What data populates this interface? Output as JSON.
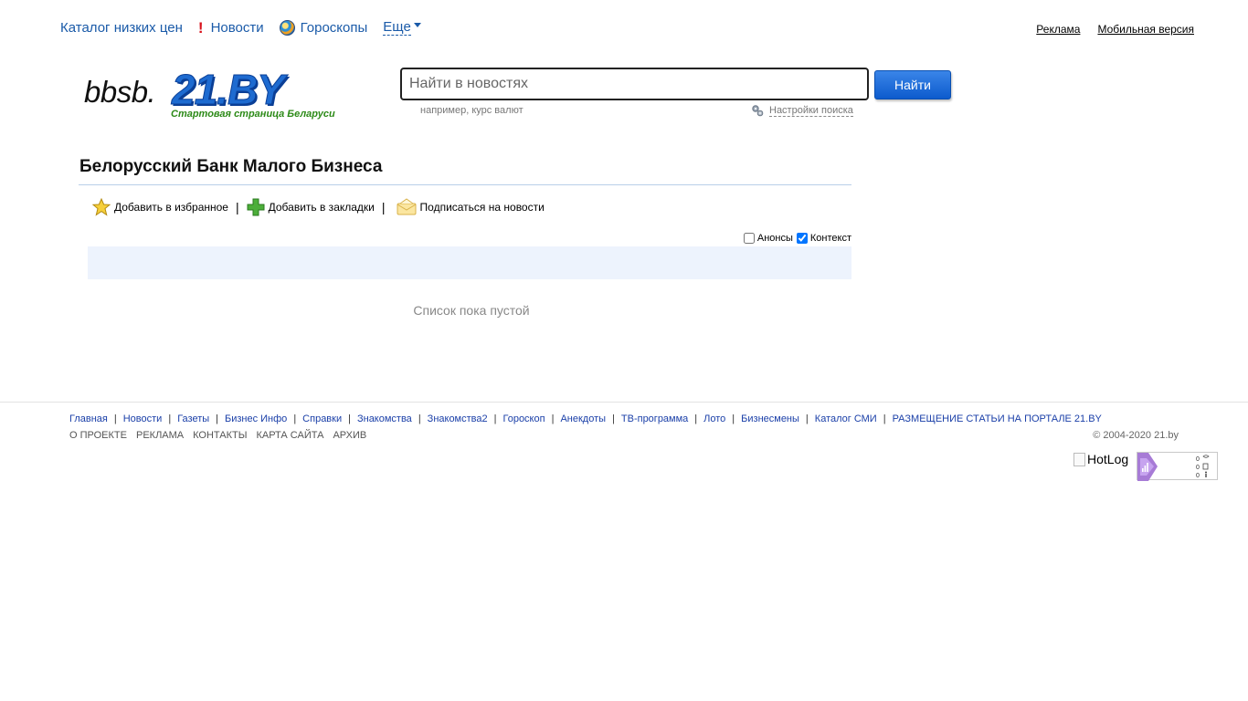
{
  "topnav": {
    "catalog": "Каталог низких цен",
    "news": "Новости",
    "horoscopes": "Гороскопы",
    "more": "Еще"
  },
  "toplinks": {
    "ads": "Реклама",
    "mobile": "Мобильная версия"
  },
  "logo": {
    "prefix": "bbsb.",
    "brand": "21.BY",
    "slogan": "Стартовая страница Беларуси"
  },
  "search": {
    "placeholder": "Найти в новостях",
    "button": "Найти",
    "hint": "например, курс валют",
    "settings": "Настройки поиска"
  },
  "page": {
    "title": "Белорусский Банк Малого Бизнеса"
  },
  "actions": {
    "favorites": "Добавить в избранное",
    "bookmarks": "Добавить в закладки",
    "subscribe": "Подписаться на новости"
  },
  "filters": {
    "announcements": {
      "label": "Анонсы",
      "checked": false
    },
    "context": {
      "label": "Контекст",
      "checked": true
    }
  },
  "list": {
    "empty": "Список пока пустой"
  },
  "footer": {
    "links": [
      "Главная",
      "Новости",
      "Газеты",
      "Бизнес Инфо",
      "Справки",
      "Знакомства",
      "Знакомства2",
      "Гороскоп",
      "Анекдоты",
      "ТВ-программа",
      "Лото",
      "Бизнесмены",
      "Каталог СМИ",
      "РАЗМЕЩЕНИЕ СТАТЬИ НА ПОРТАЛЕ 21.BY"
    ],
    "links2": [
      "О ПРОЕКТЕ",
      "РЕКЛАМА",
      "КОНТАКТЫ",
      "КАРТА САЙТА",
      "АРХИВ"
    ],
    "copyright": "© 2004-2020 21.by",
    "hotlog_alt": "HotLog",
    "counter_values": [
      "0",
      "0",
      "0"
    ]
  }
}
